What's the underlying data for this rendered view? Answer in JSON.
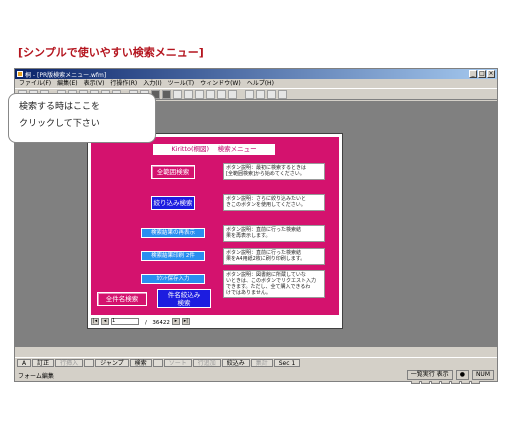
{
  "heading": "[シンプルで使いやすい検索メニュー]",
  "window": {
    "title": "桐 - [PR版検索メニュー.wfm]",
    "menu": [
      "ファイル(F)",
      "編集(E)",
      "表示(V)",
      "行操作(R)",
      "入力(I)",
      "ツール(T)",
      "ウィンドウ(W)",
      "ヘルプ(H)"
    ]
  },
  "form": {
    "title": "Kiritto(桐図)　 検索メニュー",
    "buttons": {
      "all_search": "全範囲検索",
      "narrow_search": "絞り込み検索",
      "redisplay": "検索結果の再表示",
      "print_results": "検索結果印刷 2件",
      "list_input": "ｶｳﾝﾄ保存入力",
      "all_names": "全件名検索",
      "narrow_names_1": "件名絞込み",
      "narrow_names_2": "検索"
    },
    "descriptions": {
      "d1_line1": "ボタン説明：最初に検索するときは",
      "d1_line2": "[全範囲検索]から始めてください。",
      "d2_line1": "ボタン説明：さらに絞り込みたいと",
      "d2_line2": "きこのボタンを使用してください。",
      "d3_line1": "ボタン説明：直前に行った検索結",
      "d3_line2": "果を再表示します。",
      "d4_line1": "ボタン説明：直前に行った検索結",
      "d4_line2": "果をA4用紙2枚に刷り印刷します。",
      "d5_line1": "ボタン説明：図書館に所蔵していな",
      "d5_line2": "いときは、このボタンでリクエスト入力",
      "d5_line3": "できます。ただし、全て購入できるわ",
      "d5_line4": "けではありません。"
    },
    "navbar": {
      "current": "1",
      "total": "/　36422"
    }
  },
  "callout": {
    "line1": "検索する時はここを",
    "line2": "クリックして下さい"
  },
  "tabs": [
    "A",
    "訂正",
    "行挿入",
    "",
    "ジャンプ",
    "検索",
    "",
    "ソート",
    "行追加",
    "絞込み",
    "集計",
    "Sec 1"
  ],
  "tabs_dim": [
    false,
    false,
    true,
    false,
    false,
    false,
    false,
    true,
    true,
    false,
    true,
    false
  ],
  "status": {
    "left": "フォーム編集",
    "mode": "一覧実行 表示",
    "num": "NUM"
  },
  "colors": {
    "form_bg": "#d4126e",
    "heading": "#b4141e",
    "button_blue": "#1c1ce0",
    "button_cyan": "#2a8ef0"
  }
}
